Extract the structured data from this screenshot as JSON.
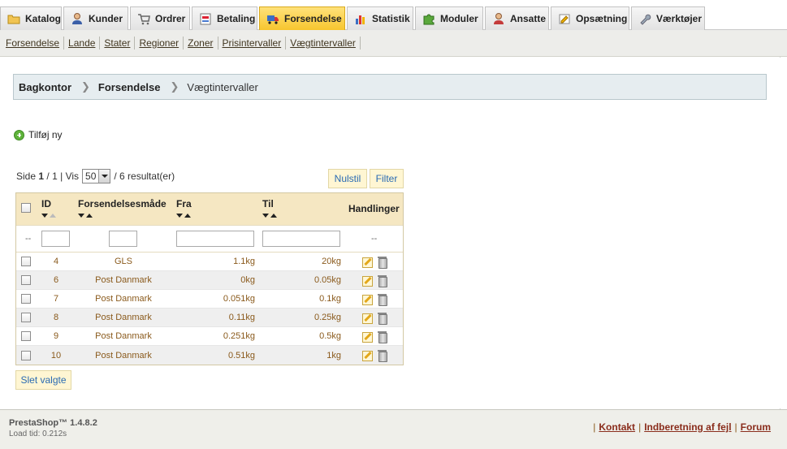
{
  "tabs": [
    {
      "label": "Katalog",
      "icon": "folder-icon"
    },
    {
      "label": "Kunder",
      "icon": "user-icon"
    },
    {
      "label": "Ordrer",
      "icon": "cart-icon"
    },
    {
      "label": "Betaling",
      "icon": "payment-icon"
    },
    {
      "label": "Forsendelse",
      "icon": "truck-icon",
      "active": true
    },
    {
      "label": "Statistik",
      "icon": "chart-icon"
    },
    {
      "label": "Moduler",
      "icon": "puzzle-icon"
    },
    {
      "label": "Ansatte",
      "icon": "employee-icon"
    },
    {
      "label": "Opsætning",
      "icon": "settings-icon"
    },
    {
      "label": "Værktøjer",
      "icon": "wrench-icon"
    }
  ],
  "subnav": [
    "Forsendelse",
    "Lande",
    "Stater",
    "Regioner",
    "Zoner",
    "Prisintervaller",
    "Vægtintervaller"
  ],
  "breadcrumb": {
    "root": "Bagkontor",
    "section": "Forsendelse",
    "current": "Vægtintervaller"
  },
  "add_new_label": "Tilføj ny",
  "pager": {
    "side_label": "Side",
    "page": "1",
    "pages": "1",
    "vis_label": "Vis",
    "per_page": "50",
    "results": "/ 6 resultat(er)"
  },
  "buttons": {
    "reset": "Nulstil",
    "filter": "Filter",
    "delete_selected": "Slet valgte"
  },
  "table": {
    "headers": {
      "id": "ID",
      "method": "Forsendelsesmåde",
      "from": "Fra",
      "to": "Til",
      "actions": "Handlinger"
    },
    "filter_placeholder": "--",
    "rows": [
      {
        "id": "4",
        "method": "GLS",
        "from": "1.1kg",
        "to": "20kg"
      },
      {
        "id": "6",
        "method": "Post Danmark",
        "from": "0kg",
        "to": "0.05kg"
      },
      {
        "id": "7",
        "method": "Post Danmark",
        "from": "0.051kg",
        "to": "0.1kg"
      },
      {
        "id": "8",
        "method": "Post Danmark",
        "from": "0.11kg",
        "to": "0.25kg"
      },
      {
        "id": "9",
        "method": "Post Danmark",
        "from": "0.251kg",
        "to": "0.5kg"
      },
      {
        "id": "10",
        "method": "Post Danmark",
        "from": "0.51kg",
        "to": "1kg"
      }
    ]
  },
  "footer": {
    "brand": "PrestaShop™ 1.4.8.2",
    "load_time": "Load tid: 0.212s",
    "links": [
      "Kontakt",
      "Indberetning af fejl",
      "Forum"
    ]
  },
  "colors": {
    "active_tab": "#f7c62e",
    "table_header": "#f5e7c2",
    "link_brown": "#8a5a1c"
  }
}
